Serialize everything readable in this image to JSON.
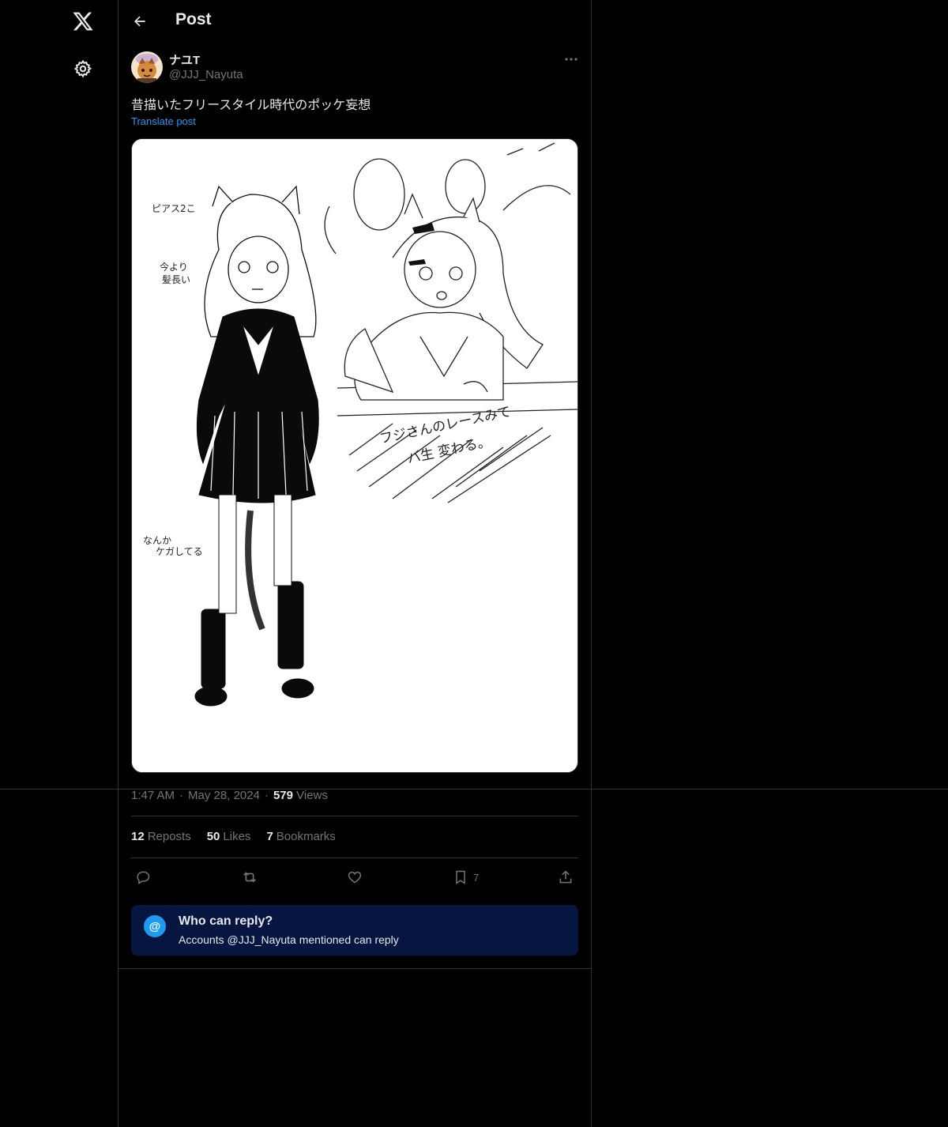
{
  "header": {
    "title": "Post"
  },
  "author": {
    "name": "ナユT",
    "handle": "@JJJ_Nayuta"
  },
  "post": {
    "text": "昔描いたフリースタイル時代のポッケ妄想",
    "translate_label": "Translate post",
    "media": {
      "notes": [
        "ピアス2こ",
        "今より",
        "髪長い",
        "なんか",
        "ケガしてる",
        "フジさんのレースみて",
        "バ生 変わる。"
      ]
    }
  },
  "meta": {
    "time": "1:47 AM",
    "date": "May 28, 2024",
    "views_count": "579",
    "views_label": "Views"
  },
  "stats": {
    "reposts_count": "12",
    "reposts_label": "Reposts",
    "likes_count": "50",
    "likes_label": "Likes",
    "bookmarks_count": "7",
    "bookmarks_label": "Bookmarks"
  },
  "actions": {
    "bookmark_count": "7"
  },
  "reply_restriction": {
    "icon": "@",
    "title": "Who can reply?",
    "subtitle": "Accounts @JJJ_Nayuta mentioned can reply"
  },
  "icons": [
    "x-logo-icon",
    "gear-icon",
    "back-arrow-icon",
    "more-icon",
    "reply-icon",
    "repost-icon",
    "like-icon",
    "bookmark-icon",
    "share-icon"
  ],
  "colors": {
    "background": "#000000",
    "link": "#1d9bf0",
    "muted": "#71767b",
    "reply_box": "#061640"
  }
}
